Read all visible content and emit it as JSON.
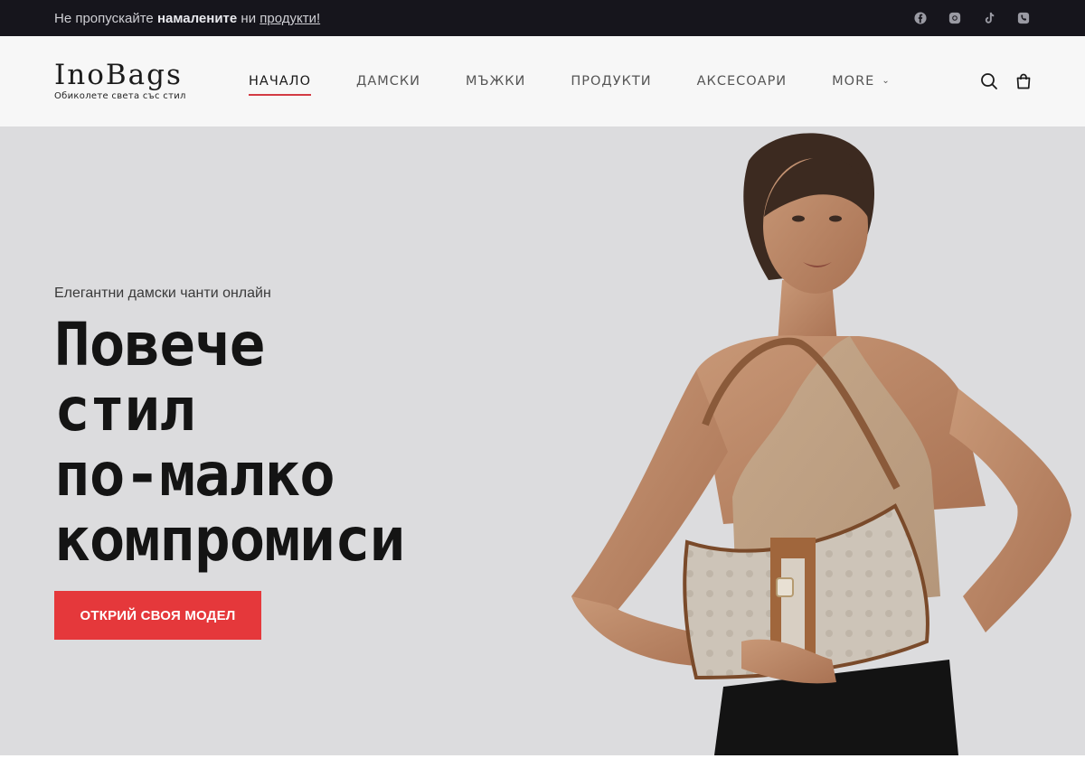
{
  "topbar": {
    "message_prefix": "Не пропускайте",
    "message_bold": "намалените",
    "message_mid": "ни",
    "message_link": "продукти!",
    "social_icons": [
      "facebook-icon",
      "instagram-icon",
      "tiktok-icon",
      "phone-icon"
    ]
  },
  "header": {
    "logo_title": "InoBags",
    "logo_tagline": "Обиколете света със стил",
    "nav": [
      {
        "label": "НАЧАЛО",
        "active": true
      },
      {
        "label": "ДАМСКИ",
        "active": false
      },
      {
        "label": "МЪЖКИ",
        "active": false
      },
      {
        "label": "ПРОДУКТИ",
        "active": false
      },
      {
        "label": "АКСЕСОАРИ",
        "active": false
      },
      {
        "label": "MORE",
        "active": false
      }
    ]
  },
  "hero": {
    "eyebrow": "Елегантни дамски чанти онлайн",
    "headline_lines": [
      "Повече",
      "стил",
      "по-малко",
      "компромиси"
    ],
    "cta_label": "ОТКРИЙ СВОЯ МОДЕЛ",
    "image_alt": "Жена с бежова дамска чанта"
  },
  "colors": {
    "accent": "#e5383b",
    "topbar_bg": "#16151c",
    "header_bg": "#f7f7f7",
    "hero_bg": "#dcdcde"
  }
}
